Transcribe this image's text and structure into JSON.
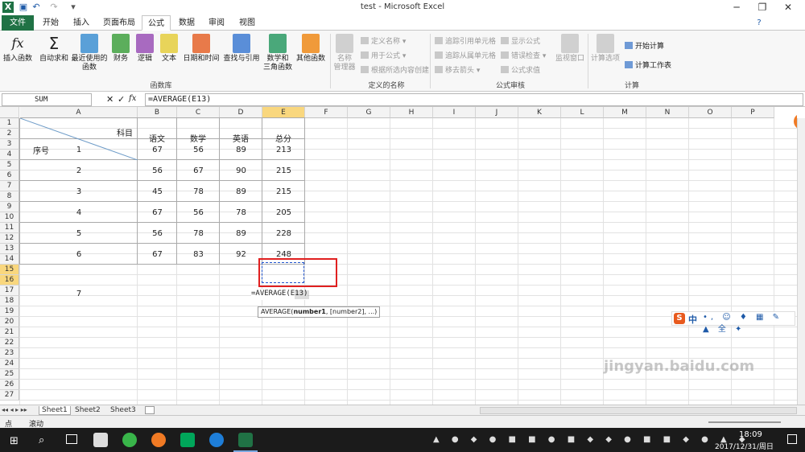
{
  "titlebar": {
    "title": "test - Microsoft Excel",
    "min": "─",
    "restore": "❐",
    "close": "✕"
  },
  "tabs": [
    "文件",
    "开始",
    "插入",
    "页面布局",
    "公式",
    "数据",
    "审阅",
    "视图"
  ],
  "ribbon": {
    "function_library": {
      "insert_function": "插入函数",
      "autosum": "自动求和",
      "recent": [
        "最近使用的",
        "函数"
      ],
      "finance": "财务",
      "logical": "逻辑",
      "text": "文本",
      "datetime": "日期和时间",
      "lookup": "查找与引用",
      "math": [
        "数学和",
        "三角函数"
      ],
      "other": "其他函数",
      "group_label": "函数库"
    },
    "defined_names": {
      "name_manager": [
        "名称",
        "管理器"
      ],
      "define_name": "定义名称",
      "use_in_formula": "用于公式",
      "create_from_selection": "根据所选内容创建",
      "group_label": "定义的名称"
    },
    "formula_auditing": {
      "trace_precedents": "追踪引用单元格",
      "trace_dependents": "追踪从属单元格",
      "remove_arrows": "移去箭头",
      "show_formulas": "显示公式",
      "error_checking": "错误检查",
      "evaluate_formula": "公式求值",
      "watch_window": "监视窗口",
      "group_label": "公式审核"
    },
    "calculation": {
      "options": "计算选项",
      "calc_now": "开始计算",
      "calc_sheet": "计算工作表",
      "group_label": "计算"
    }
  },
  "formula_bar": {
    "name_box": "SUM",
    "fx": "fx",
    "formula": "=AVERAGE(E13)"
  },
  "grid": {
    "columns": [
      "A",
      "B",
      "C",
      "D",
      "E",
      "F",
      "G",
      "H",
      "I",
      "J",
      "K",
      "L",
      "M",
      "N",
      "O",
      "P"
    ],
    "rows": [
      "1",
      "2",
      "3",
      "4",
      "5",
      "6",
      "7",
      "8",
      "9",
      "10",
      "11",
      "12",
      "13",
      "14",
      "15",
      "16",
      "17",
      "18",
      "19",
      "20",
      "21",
      "22",
      "23",
      "24",
      "25",
      "26",
      "27"
    ],
    "header": {
      "subject": "科目",
      "serial": "序号",
      "chinese": "语文",
      "math": "数学",
      "english": "英语",
      "total": "总分"
    },
    "data": [
      [
        "1",
        "67",
        "56",
        "89",
        "213"
      ],
      [
        "2",
        "56",
        "67",
        "90",
        "215"
      ],
      [
        "3",
        "45",
        "78",
        "89",
        "215"
      ],
      [
        "4",
        "67",
        "56",
        "78",
        "205"
      ],
      [
        "5",
        "56",
        "78",
        "89",
        "228"
      ],
      [
        "6",
        "67",
        "83",
        "92",
        "248"
      ]
    ],
    "row7_serial": "7",
    "editing_text": "=AVERAGE(E13)",
    "tooltip": {
      "fn": "AVERAGE(",
      "arg1": "number1",
      "rest": ", [number2], ...)"
    }
  },
  "sheets": [
    "Sheet1",
    "Sheet2",
    "Sheet3"
  ],
  "status": {
    "mode": "点",
    "scroll": "滚动"
  },
  "taskbar": {
    "time": "18:09",
    "date": "2017/12/31/周日"
  },
  "ime": {
    "label": "中"
  },
  "watermark": {
    "text": "jingyan.baidu.com"
  },
  "colors": {
    "file_tab": "#207245",
    "selection": "#f9d77e",
    "highlight_box": "#e02020"
  }
}
